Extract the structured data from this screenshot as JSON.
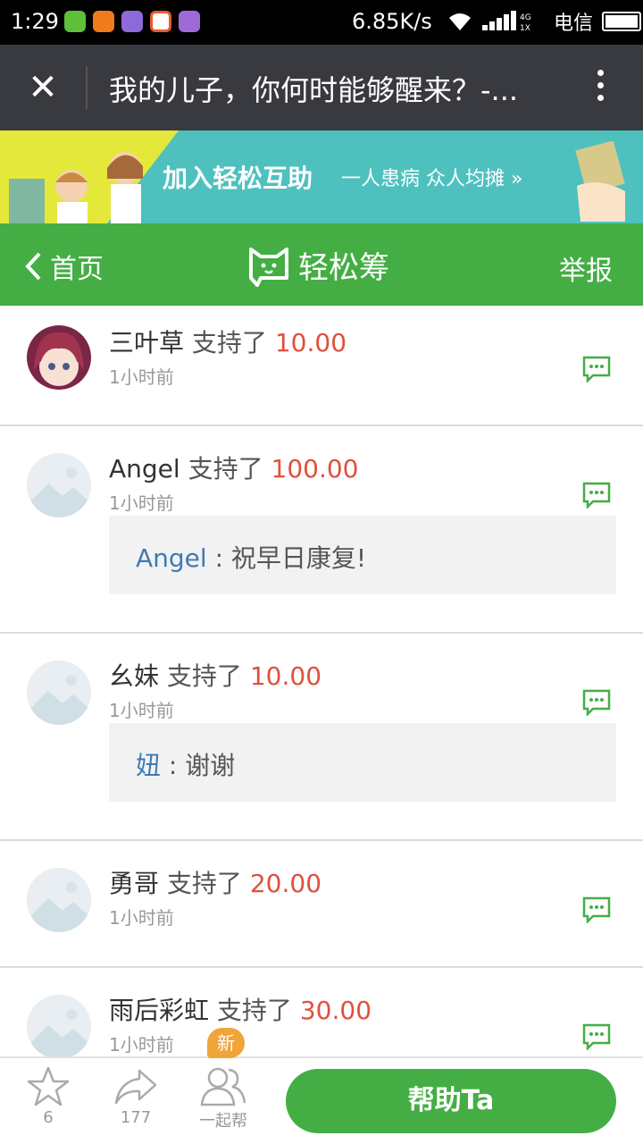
{
  "status_bar": {
    "time": "1:29",
    "speed": "6.85K/s",
    "network_small": "4G\n1X",
    "carrier": "电信",
    "app_icon_colors": [
      "#5fbf3a",
      "#f07b1b",
      "#8e6ad8",
      "#e85a2c",
      "#9f6ad8"
    ]
  },
  "titlebar": {
    "title": "我的儿子，你何时能够醒来？-...",
    "close_icon": "close-icon",
    "more_icon": "more-vertical-icon"
  },
  "banner": {
    "headline": "加入轻松互助",
    "tagline": "一人患病  众人均摊  »"
  },
  "navbar": {
    "back_label": "首页",
    "brand": "轻松筹",
    "report_label": "举报",
    "color": "#44ae44"
  },
  "feed": [
    {
      "name": "三叶草",
      "verb": "支持了",
      "amount": "10.00",
      "time": "1小时前",
      "avatar": "anime-girl"
    },
    {
      "name": "Angel",
      "verb": "支持了",
      "amount": "100.00",
      "time": "1小时前",
      "avatar": "placeholder",
      "comment": {
        "who": "Angel",
        "sep": " : ",
        "text": "祝早日康复!"
      }
    },
    {
      "name": "幺妹",
      "verb": "支持了",
      "amount": "10.00",
      "time": "1小时前",
      "avatar": "placeholder",
      "comment": {
        "who": "妞",
        "sep": " : ",
        "text": "谢谢"
      }
    },
    {
      "name": "勇哥",
      "verb": "支持了",
      "amount": "20.00",
      "time": "1小时前",
      "avatar": "placeholder"
    },
    {
      "name": "雨后彩虹",
      "verb": "支持了",
      "amount": "30.00",
      "time": "1小时前",
      "avatar": "placeholder"
    }
  ],
  "bottom_bar": {
    "favorite_count": "6",
    "share_count": "177",
    "together_label": "一起帮",
    "new_badge": "新",
    "help_button": "帮助Ta"
  }
}
